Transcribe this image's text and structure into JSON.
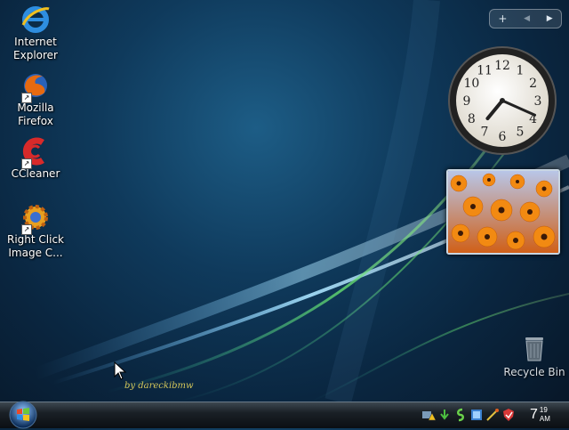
{
  "desktop": {
    "icons": [
      {
        "label": "Internet Explorer",
        "icon": "internet-explorer-icon"
      },
      {
        "label": "Mozilla Firefox",
        "icon": "firefox-icon"
      },
      {
        "label": "CCleaner",
        "icon": "ccleaner-icon"
      },
      {
        "label": "Right Click Image C...",
        "icon": "right-click-image-converter-icon"
      }
    ],
    "recycle_bin": {
      "label": "Recycle Bin",
      "icon": "recycle-bin-icon"
    },
    "signature": "by dareckibmw"
  },
  "sidebar": {
    "controls": {
      "add": "+",
      "prev": "◀",
      "next": "▶"
    },
    "clock": {
      "numbers": [
        "12",
        "1",
        "2",
        "3",
        "4",
        "5",
        "6",
        "7",
        "8",
        "9",
        "10",
        "11"
      ],
      "time": "7:19"
    },
    "slideshow": {
      "subject": "orange flowers"
    }
  },
  "taskbar": {
    "start_icon": "windows-orb-icon",
    "tray_icons": [
      "network-warning-icon",
      "download-icon",
      "app-icon",
      "update-icon",
      "connection-icon",
      "security-icon"
    ],
    "clock": {
      "hour": "7",
      "minute": "19",
      "ampm": "AM"
    }
  },
  "colors": {
    "accent": "#1e6ea8",
    "taskbar": "#1a2026"
  }
}
